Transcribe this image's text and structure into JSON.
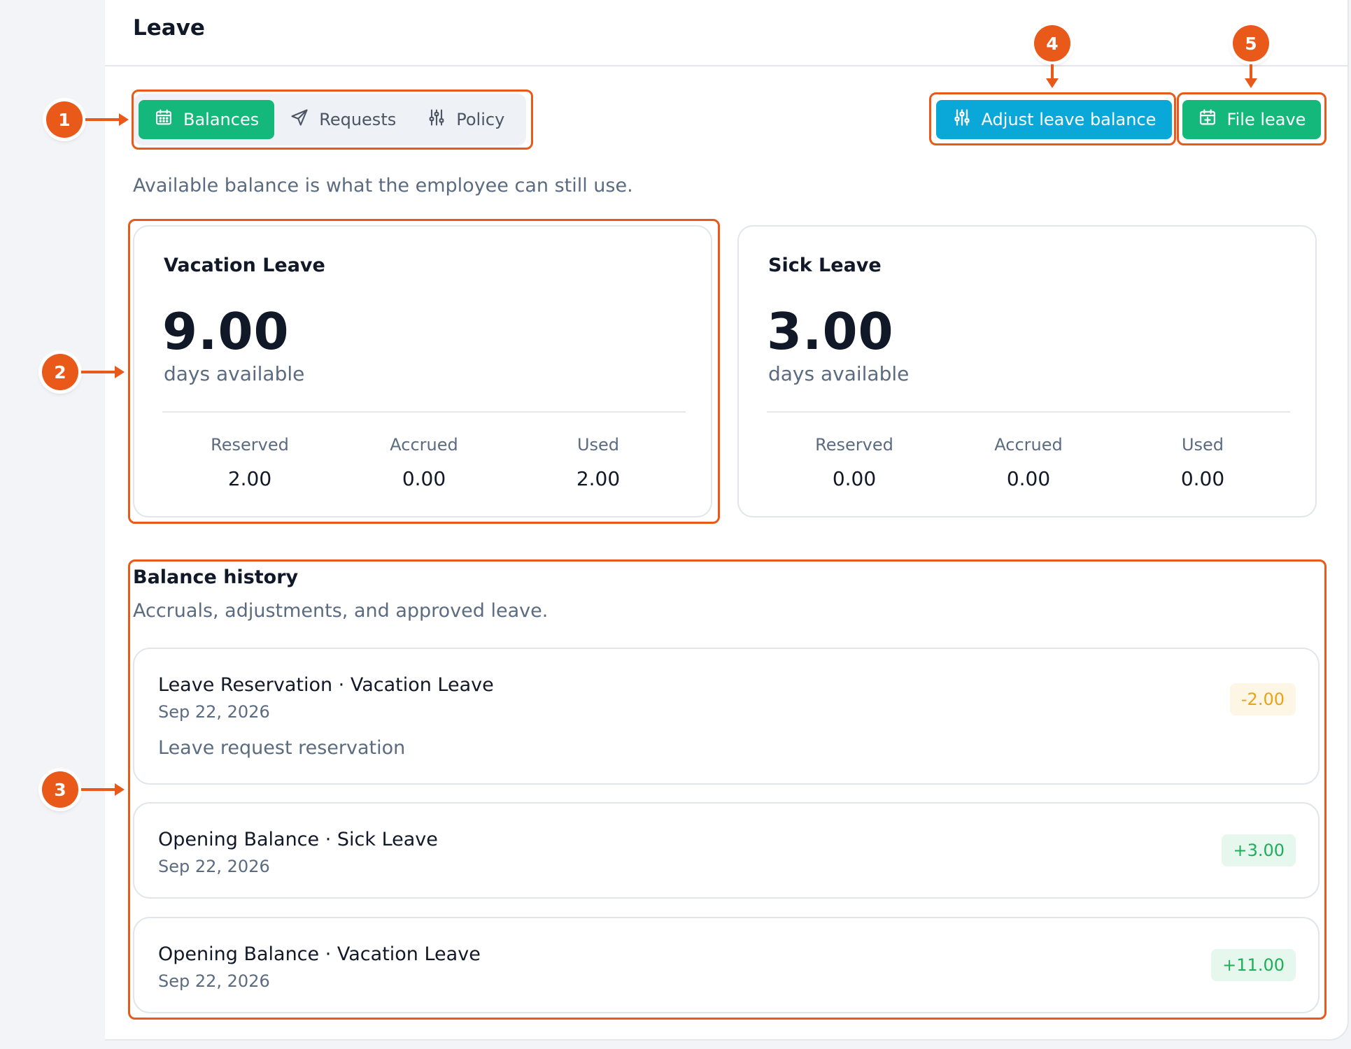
{
  "page": {
    "title": "Leave"
  },
  "tabs": [
    {
      "label": "Balances",
      "icon": "calendar-icon",
      "active": true
    },
    {
      "label": "Requests",
      "icon": "send-icon",
      "active": false
    },
    {
      "label": "Policy",
      "icon": "sliders-icon",
      "active": false
    }
  ],
  "actions": {
    "adjust_label": "Adjust leave balance",
    "file_label": "File leave"
  },
  "helper_text": "Available balance is what the employee can still use.",
  "balances": [
    {
      "title": "Vacation Leave",
      "value": "9.00",
      "sub": "days available",
      "stats": [
        {
          "label": "Reserved",
          "value": "2.00"
        },
        {
          "label": "Accrued",
          "value": "0.00"
        },
        {
          "label": "Used",
          "value": "2.00"
        }
      ]
    },
    {
      "title": "Sick Leave",
      "value": "3.00",
      "sub": "days available",
      "stats": [
        {
          "label": "Reserved",
          "value": "0.00"
        },
        {
          "label": "Accrued",
          "value": "0.00"
        },
        {
          "label": "Used",
          "value": "0.00"
        }
      ]
    }
  ],
  "history": {
    "title": "Balance history",
    "subtitle": "Accruals, adjustments, and approved leave.",
    "items": [
      {
        "title": "Leave Reservation · Vacation Leave",
        "date": "Sep 22, 2026",
        "note": "Leave request reservation",
        "amount": "-2.00"
      },
      {
        "title": "Opening Balance · Sick Leave",
        "date": "Sep 22, 2026",
        "amount": "+3.00"
      },
      {
        "title": "Opening Balance · Vacation Leave",
        "date": "Sep 22, 2026",
        "amount": "+11.00"
      }
    ]
  },
  "callouts": [
    "1",
    "2",
    "3",
    "4",
    "5"
  ],
  "colors": {
    "primary_green": "#14b87a",
    "accent_cyan": "#0aa8d8",
    "callout_orange": "#e8591a",
    "negative_amount": "#e8a317",
    "positive_amount": "#1fae5a"
  }
}
